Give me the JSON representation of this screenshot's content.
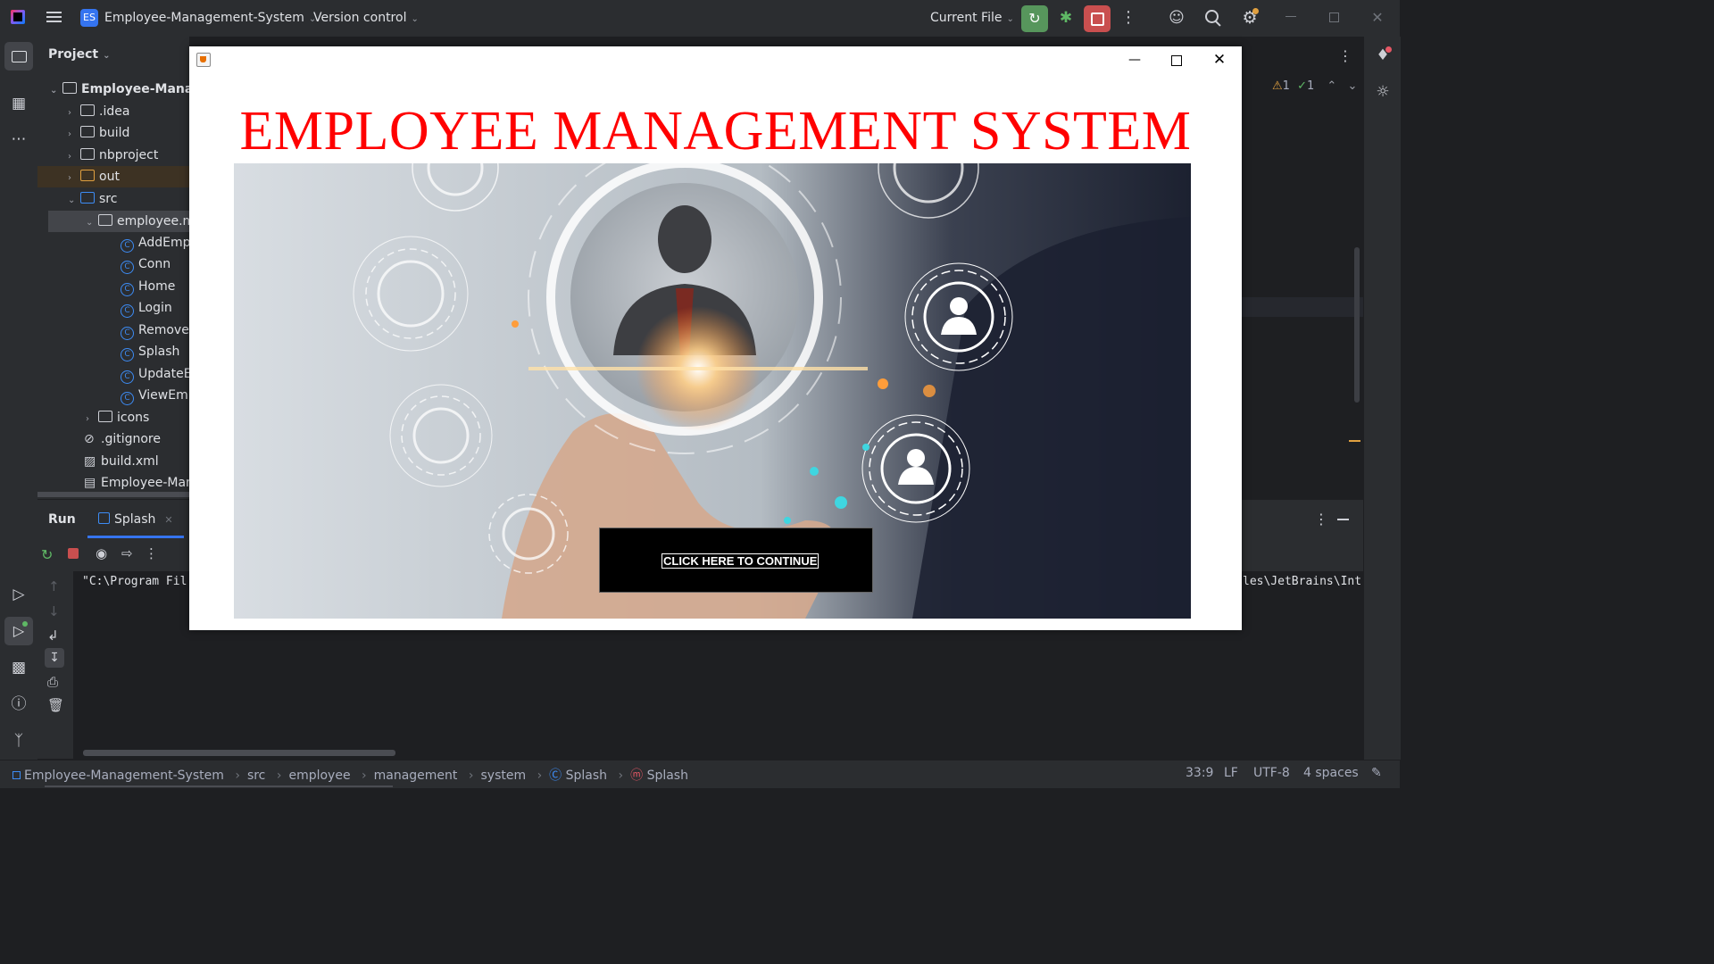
{
  "topbar": {
    "project_badge": "ES",
    "project_name": "Employee-Management-System",
    "vcs": "Version control",
    "run_config": "Current File"
  },
  "project_panel": {
    "title": "Project",
    "items": [
      {
        "label": "Employee-Manag",
        "type": "root"
      },
      {
        "label": ".idea",
        "type": "folder"
      },
      {
        "label": "build",
        "type": "folder"
      },
      {
        "label": "nbproject",
        "type": "folder"
      },
      {
        "label": "out",
        "type": "folder"
      },
      {
        "label": "src",
        "type": "folder"
      },
      {
        "label": "employee.ma",
        "type": "package"
      },
      {
        "label": "AddEmpl",
        "type": "class"
      },
      {
        "label": "Conn",
        "type": "class"
      },
      {
        "label": "Home",
        "type": "class"
      },
      {
        "label": "Login",
        "type": "class"
      },
      {
        "label": "RemoveE",
        "type": "class"
      },
      {
        "label": "Splash",
        "type": "class"
      },
      {
        "label": "UpdateEr",
        "type": "class"
      },
      {
        "label": "ViewEmp",
        "type": "class"
      },
      {
        "label": "icons",
        "type": "package"
      },
      {
        "label": ".gitignore",
        "type": "file"
      },
      {
        "label": "build.xml",
        "type": "file"
      },
      {
        "label": "Employee-Mana",
        "type": "file"
      }
    ]
  },
  "editor": {
    "warnings": "1",
    "checks": "1"
  },
  "run_panel": {
    "tab_run": "Run",
    "tab_splash": "Splash",
    "console_left": "\"C:\\Program Fil",
    "console_right": "les\\JetBrains\\Int"
  },
  "statusbar": {
    "crumbs": [
      "Employee-Management-System",
      "src",
      "employee",
      "management",
      "system",
      "Splash",
      "Splash"
    ],
    "position": "33:9",
    "line_sep": "LF",
    "encoding": "UTF-8",
    "indent": "4 spaces"
  },
  "java_window": {
    "heading": "EMPLOYEE MANAGEMENT SYSTEM",
    "button_label": "CLICK HERE TO CONTINUE"
  },
  "colors": {
    "heading": "#ff0000",
    "run_green": "#57965c",
    "stop_red": "#c94f4f",
    "accent_blue": "#3d8cf5"
  }
}
